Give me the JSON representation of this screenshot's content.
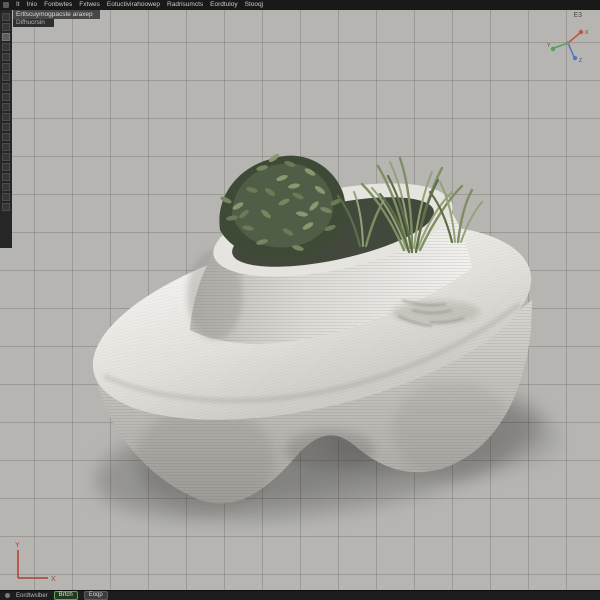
{
  "menu_bar": {
    "items": [
      {
        "label": "It"
      },
      {
        "label": "Inio"
      },
      {
        "label": "Fonbwtes"
      },
      {
        "label": "Fxtwes"
      },
      {
        "label": "Eotuctivirahoowep"
      },
      {
        "label": "Radrisumcts"
      },
      {
        "label": "Eordtuloy"
      },
      {
        "label": "Stooqj"
      }
    ]
  },
  "view_header": {
    "line1": "Ertlscuymogpacste araxep",
    "line2": "Difhucrsin"
  },
  "viewport": {
    "corner_label": "E3",
    "background": "#b6b5b2",
    "grid_line_color": "#8f8e8a",
    "grid_spacing_px": 38
  },
  "toolbar": {
    "slots": 20
  },
  "gizmo": {
    "x_label": "X",
    "y_label": "Y",
    "z_label": "Z",
    "x_color": "#c8503c",
    "y_color": "#56a05a",
    "z_color": "#4f74c8"
  },
  "axis_widget": {
    "y_label": "Y",
    "x_label": "X",
    "color": "#c0392b"
  },
  "status_bar": {
    "text": "Eordtwslber",
    "buttons": [
      {
        "label": "Brtch"
      },
      {
        "label": "Eoqp"
      }
    ]
  },
  "scene": {
    "object": "3d-printed bench with integrated planter and plants",
    "bench_color": "#e9e7e2",
    "bench_shade_color": "#aeaca7",
    "planter_opening_color": "#43483c",
    "foliage_dark": "#3f4a36",
    "foliage_mid": "#6b7a54",
    "foliage_light": "#8a9870",
    "grass_color": "#7f8f63",
    "shadow_opacity": 0.2
  }
}
